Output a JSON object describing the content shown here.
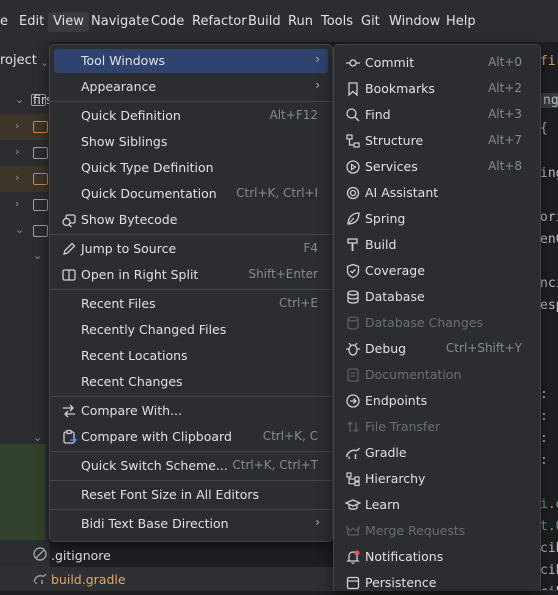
{
  "menubar": {
    "items": [
      "e",
      "Edit",
      "View",
      "Navigate",
      "Code",
      "Refactor",
      "Build",
      "Run",
      "Tools",
      "Git",
      "Window",
      "Help"
    ]
  },
  "project": {
    "label": "roject",
    "root_name": "firs",
    "files": [
      ".gitignore",
      "build.gradle"
    ]
  },
  "editor": {
    "tab_fragment": "first",
    "lines": [
      "ng",
      "{",
      "",
      "ing",
      "",
      "ori",
      "enC",
      "",
      "nci",
      "esp",
      "",
      "",
      "",
      "",
      "",
      ":",
      ":",
      ":",
      ":",
      "",
      "i.e",
      "t.0",
      "cib",
      "cib",
      "cib"
    ]
  },
  "view_menu": {
    "items": [
      {
        "label": "Tool Windows",
        "shortcut": "",
        "submenu": true,
        "highlighted": true
      },
      {
        "label": "Appearance",
        "shortcut": "",
        "submenu": true
      },
      {
        "label": "Quick Definition",
        "shortcut": "Alt+F12"
      },
      {
        "label": "Show Siblings",
        "shortcut": ""
      },
      {
        "label": "Quick Type Definition",
        "shortcut": ""
      },
      {
        "label": "Quick Documentation",
        "shortcut": "Ctrl+K, Ctrl+I"
      },
      {
        "label": "Show Bytecode",
        "shortcut": "",
        "icon": "bytecode-icon"
      },
      {
        "label": "Jump to Source",
        "shortcut": "F4",
        "icon": "pencil-icon"
      },
      {
        "label": "Open in Right Split",
        "shortcut": "Shift+Enter",
        "icon": "split-icon"
      },
      {
        "label": "Recent Files",
        "shortcut": "Ctrl+E"
      },
      {
        "label": "Recently Changed Files",
        "shortcut": ""
      },
      {
        "label": "Recent Locations",
        "shortcut": ""
      },
      {
        "label": "Recent Changes",
        "shortcut": ""
      },
      {
        "label": "Compare With...",
        "shortcut": "",
        "icon": "compare-icon"
      },
      {
        "label": "Compare with Clipboard",
        "shortcut": "Ctrl+K, C",
        "icon": "clipboard-icon"
      },
      {
        "label": "Quick Switch Scheme...",
        "shortcut": "Ctrl+K, Ctrl+T"
      },
      {
        "label": "Reset Font Size in All Editors",
        "shortcut": ""
      },
      {
        "label": "Bidi Text Base Direction",
        "shortcut": "",
        "submenu": true
      }
    ]
  },
  "tool_windows_menu": {
    "items": [
      {
        "label": "Commit",
        "shortcut": "Alt+0",
        "icon": "commit-icon"
      },
      {
        "label": "Bookmarks",
        "shortcut": "Alt+2",
        "icon": "bookmark-icon"
      },
      {
        "label": "Find",
        "shortcut": "Alt+3",
        "icon": "find-icon"
      },
      {
        "label": "Structure",
        "shortcut": "Alt+7",
        "icon": "structure-icon"
      },
      {
        "label": "Services",
        "shortcut": "Alt+8",
        "icon": "services-icon"
      },
      {
        "label": "AI Assistant",
        "shortcut": "",
        "icon": "ai-assistant-icon"
      },
      {
        "label": "Spring",
        "shortcut": "",
        "icon": "spring-icon"
      },
      {
        "label": "Build",
        "shortcut": "",
        "icon": "build-icon"
      },
      {
        "label": "Coverage",
        "shortcut": "",
        "icon": "coverage-icon"
      },
      {
        "label": "Database",
        "shortcut": "",
        "icon": "database-icon"
      },
      {
        "label": "Database Changes",
        "shortcut": "",
        "icon": "database-changes-icon",
        "disabled": true
      },
      {
        "label": "Debug",
        "shortcut": "Ctrl+Shift+Y",
        "icon": "debug-icon"
      },
      {
        "label": "Documentation",
        "shortcut": "",
        "icon": "documentation-icon",
        "disabled": true
      },
      {
        "label": "Endpoints",
        "shortcut": "",
        "icon": "endpoints-icon"
      },
      {
        "label": "File Transfer",
        "shortcut": "",
        "icon": "file-transfer-icon",
        "disabled": true
      },
      {
        "label": "Gradle",
        "shortcut": "",
        "icon": "gradle-icon"
      },
      {
        "label": "Hierarchy",
        "shortcut": "",
        "icon": "hierarchy-icon"
      },
      {
        "label": "Learn",
        "shortcut": "",
        "icon": "learn-icon"
      },
      {
        "label": "Merge Requests",
        "shortcut": "",
        "icon": "merge-requests-icon",
        "disabled": true
      },
      {
        "label": "Notifications",
        "shortcut": "",
        "icon": "notifications-icon"
      },
      {
        "label": "Persistence",
        "shortcut": "",
        "icon": "persistence-icon"
      }
    ]
  },
  "colors": {
    "background": "#1e1f22",
    "panel": "#2b2d30",
    "highlight": "#2e436e",
    "text": "#dfe1e5",
    "shortcut": "#868a91",
    "disabled": "#6b6e73"
  }
}
